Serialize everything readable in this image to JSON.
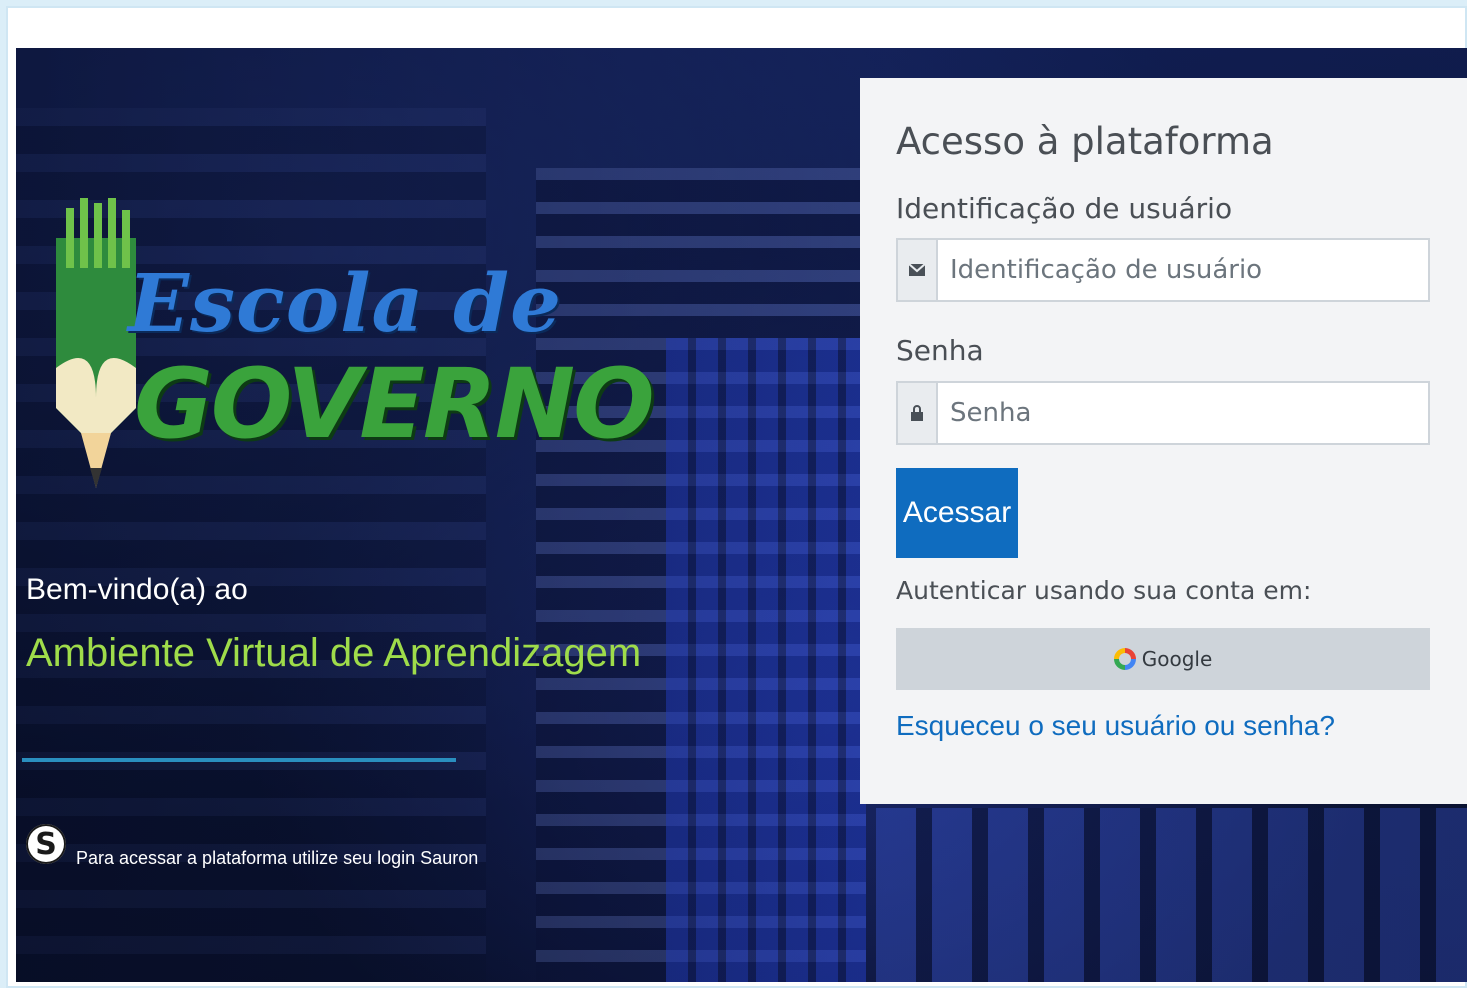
{
  "login": {
    "title": "Acesso à plataforma",
    "username_label": "Identificação de usuário",
    "username_placeholder": "Identificação de usuário",
    "password_label": "Senha",
    "password_placeholder": "Senha",
    "submit_label": "Acessar",
    "auth_with_label": "Autenticar usando sua conta em:",
    "google_label": "Google",
    "forgot_link": "Esqueceu o seu usuário ou senha?"
  },
  "branding": {
    "logo_line1": "Escola de",
    "logo_line2": "GOVERNO",
    "welcome_text": "Bem-vindo(a) ao",
    "ava_text": "Ambiente Virtual de Aprendizagem",
    "sauron_icon_letter": "S",
    "sauron_text": "Para acessar a plataforma utilize seu login Sauron"
  },
  "colors": {
    "primary": "#0f6cbf",
    "ava_green": "#9fdc4a",
    "logo_blue": "#2f7ad6",
    "logo_green": "#3aa33c"
  },
  "icons": {
    "username_addon": "envelope-icon",
    "password_addon": "lock-icon",
    "google": "google-icon"
  }
}
